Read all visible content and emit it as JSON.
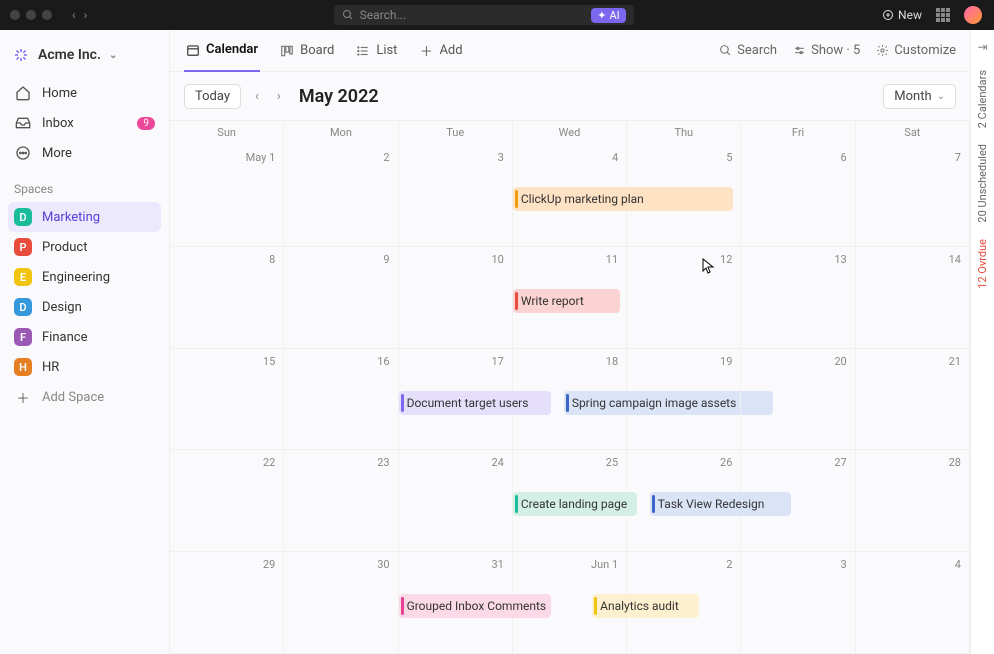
{
  "titlebar": {
    "search_placeholder": "Search...",
    "ai_label": "AI",
    "new_label": "New"
  },
  "workspace": {
    "name": "Acme Inc."
  },
  "nav": {
    "home": "Home",
    "inbox": "Inbox",
    "inbox_badge": "9",
    "more": "More"
  },
  "spaces": {
    "label": "Spaces",
    "items": [
      {
        "letter": "D",
        "name": "Marketing",
        "color": "#1abc9c",
        "active": true
      },
      {
        "letter": "P",
        "name": "Product",
        "color": "#e74c3c"
      },
      {
        "letter": "E",
        "name": "Engineering",
        "color": "#f1c40f"
      },
      {
        "letter": "D",
        "name": "Design",
        "color": "#3498db"
      },
      {
        "letter": "F",
        "name": "Finance",
        "color": "#9b59b6"
      },
      {
        "letter": "H",
        "name": "HR",
        "color": "#e67e22"
      }
    ],
    "add_label": "Add Space"
  },
  "views": {
    "calendar": "Calendar",
    "board": "Board",
    "list": "List",
    "add": "Add",
    "search": "Search",
    "show": "Show · 5",
    "customize": "Customize"
  },
  "calendar": {
    "today": "Today",
    "title": "May 2022",
    "view_mode": "Month",
    "day_headers": [
      "Sun",
      "Mon",
      "Tue",
      "Wed",
      "Thu",
      "Fri",
      "Sat"
    ],
    "days": [
      "May 1",
      "2",
      "3",
      "4",
      "5",
      "6",
      "7",
      "8",
      "9",
      "10",
      "11",
      "12",
      "13",
      "14",
      "15",
      "16",
      "17",
      "18",
      "19",
      "20",
      "21",
      "22",
      "23",
      "24",
      "25",
      "26",
      "27",
      "28",
      "29",
      "30",
      "31",
      "Jun 1",
      "2",
      "3",
      "4"
    ],
    "events": [
      {
        "title": "ClickUp marketing plan",
        "row": 0,
        "start": 3,
        "span": 2,
        "bg": "#fde2c4",
        "bar": "#f39c12"
      },
      {
        "title": "Write report",
        "row": 1,
        "start": 3,
        "span": 1,
        "bg": "#fbd3d3",
        "bar": "#e74c3c"
      },
      {
        "title": "Document target users",
        "row": 2,
        "start": 2,
        "span": 1.4,
        "bg": "#e5dffb",
        "bar": "#7b68ee"
      },
      {
        "title": "Spring campaign image assets",
        "row": 2,
        "start": 3.45,
        "span": 1.9,
        "bg": "#dbe4f7",
        "bar": "#3a66c7"
      },
      {
        "title": "Create landing page",
        "row": 3,
        "start": 3,
        "span": 1.15,
        "bg": "#d4f0e5",
        "bar": "#1abc9c"
      },
      {
        "title": "Task View Redesign",
        "row": 3,
        "start": 4.2,
        "span": 1.3,
        "bg": "#dbe4f7",
        "bar": "#3a66c7"
      },
      {
        "title": "Grouped Inbox Comments",
        "row": 4,
        "start": 2,
        "span": 1.4,
        "bg": "#fbd9e6",
        "bar": "#e84393"
      },
      {
        "title": "Analytics audit",
        "row": 4,
        "start": 3.7,
        "span": 1,
        "bg": "#fdf0cf",
        "bar": "#f1c40f"
      }
    ]
  },
  "rail": {
    "calendars": "2 Calendars",
    "unscheduled": "20 Unscheduled",
    "overdue": "12 Ovrdue"
  }
}
